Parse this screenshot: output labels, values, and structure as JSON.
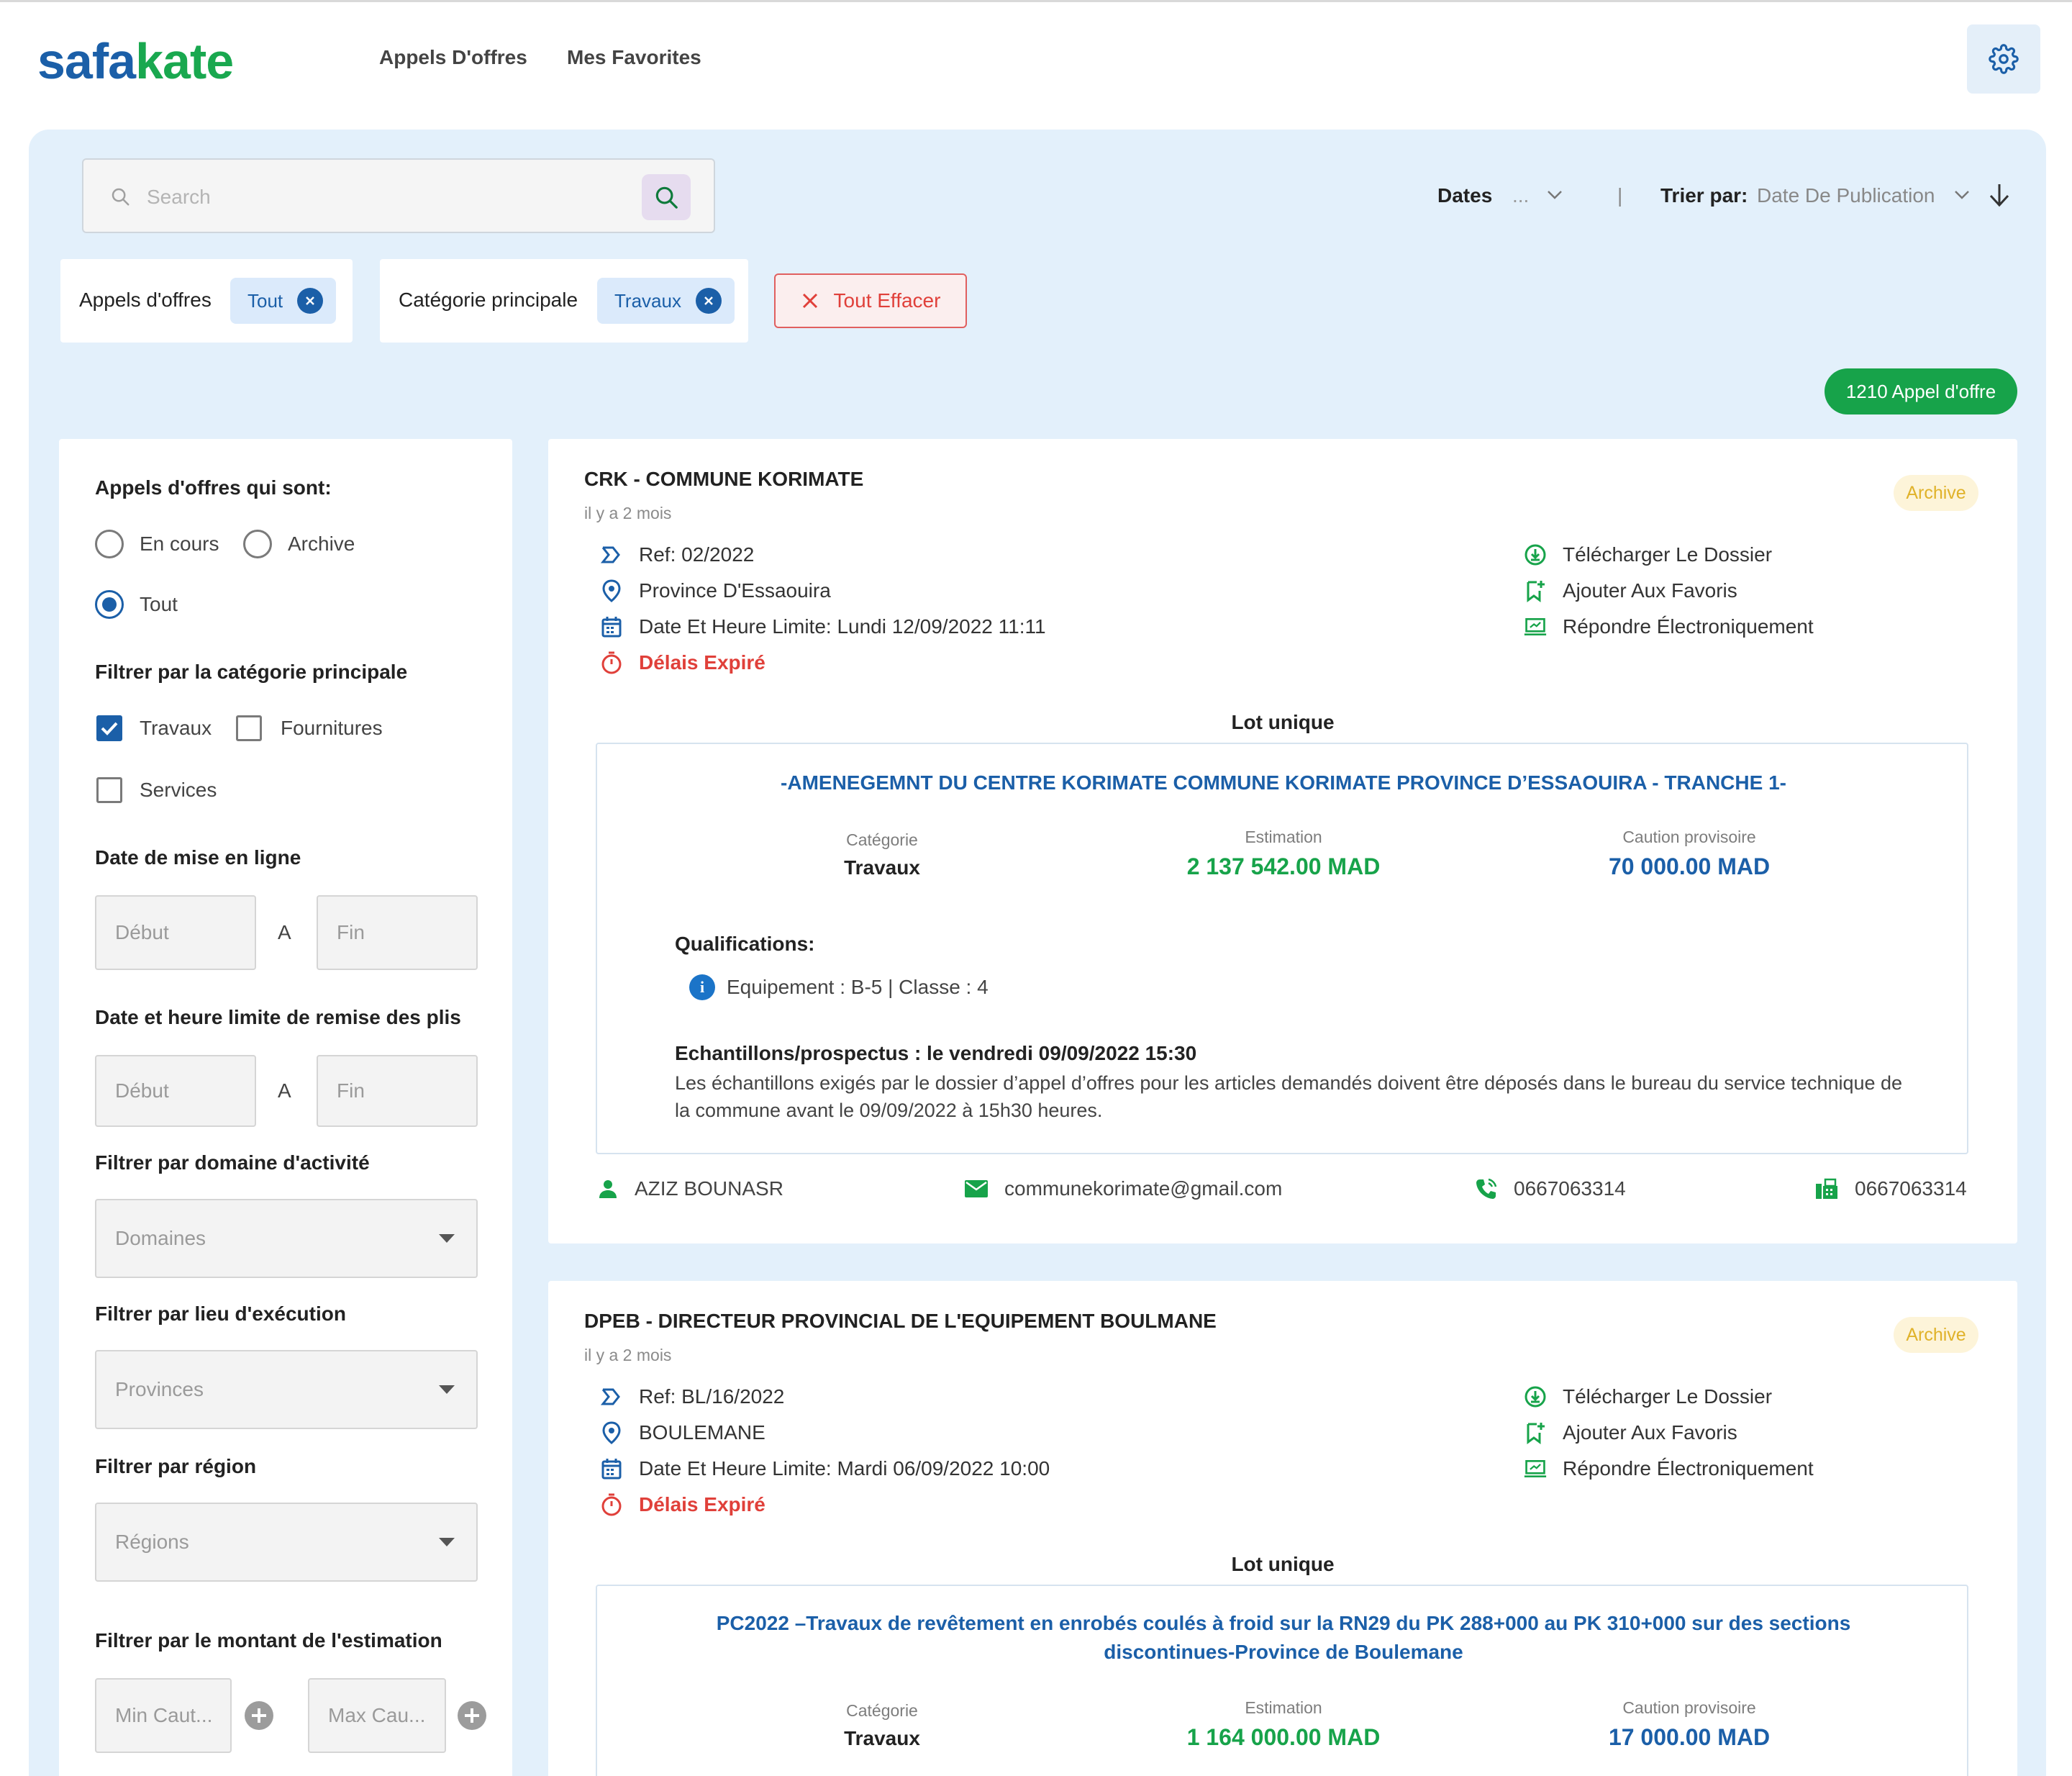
{
  "brand": {
    "logo_part1": "safa",
    "logo_part2": "kate"
  },
  "nav": {
    "items": [
      "Appels D'offres",
      "Mes Favorites"
    ]
  },
  "search": {
    "placeholder": "Search"
  },
  "sort": {
    "dates_label": "Dates",
    "dates_value": "...",
    "divider": "|",
    "sort_label": "Trier par:",
    "sort_value": "Date De Publication"
  },
  "filters_applied": [
    {
      "label": "Appels d'offres",
      "value": "Tout"
    },
    {
      "label": "Catégorie principale",
      "value": "Travaux"
    }
  ],
  "clear_all": "Tout Effacer",
  "result_count": "1210 Appel d'offre",
  "sidebar": {
    "status_title": "Appels d'offres qui sont:",
    "status_options": [
      {
        "label": "En cours",
        "selected": false
      },
      {
        "label": "Archive",
        "selected": false
      },
      {
        "label": "Tout",
        "selected": true
      }
    ],
    "category_title": "Filtrer par la catégorie principale",
    "category_options": [
      {
        "label": "Travaux",
        "checked": true
      },
      {
        "label": "Fournitures",
        "checked": false
      },
      {
        "label": "Services",
        "checked": false
      }
    ],
    "date_online_title": "Date de mise en ligne",
    "date_deadline_title": "Date et heure limite de remise des plis",
    "date_start_placeholder": "Début",
    "date_end_placeholder": "Fin",
    "date_separator": "A",
    "domain_title": "Filtrer par domaine d'activité",
    "domain_placeholder": "Domaines",
    "location_title": "Filtrer par lieu d'exécution",
    "location_placeholder": "Provinces",
    "region_title": "Filtrer par région",
    "region_placeholder": "Régions",
    "estimation_title": "Filtrer par le montant de l'estimation",
    "min_placeholder": "Min Caut...",
    "max_placeholder": "Max Cau..."
  },
  "card_actions": [
    "Télécharger Le Dossier",
    "Ajouter Aux Favoris",
    "Répondre Électroniquement"
  ],
  "labels": {
    "lot": "Lot unique",
    "category": "Catégorie",
    "estimation": "Estimation",
    "caution": "Caution provisoire",
    "qualifications": "Qualifications:"
  },
  "tenders": [
    {
      "title": "CRK - COMMUNE KORIMATE",
      "ago": "il y a 2 mois",
      "status": "Archive",
      "ref": "Ref: 02/2022",
      "location": "Province D'Essaouira",
      "deadline": "Date Et Heure Limite: Lundi 12/09/2022 11:11",
      "expired": "Délais Expiré",
      "lot_title": "-AMENEGEMNT DU CENTRE KORIMATE COMMUNE KORIMATE PROVINCE D’ESSAOUIRA - TRANCHE 1-",
      "category": "Travaux",
      "estimation": "2 137 542.00 MAD",
      "caution": "70 000.00 MAD",
      "qualification": "Equipement : B-5 | Classe : 4",
      "samples_title": "Echantillons/prospectus : le vendredi 09/09/2022 15:30",
      "samples_text": "Les échantillons exigés par le dossier d’appel d’offres pour les articles demandés doivent être déposés dans le bureau du service technique de la commune avant le 09/09/2022 à 15h30 heures.",
      "contact_name": "AZIZ BOUNASR",
      "contact_email": "communekorimate@gmail.com",
      "contact_phone": "0667063314",
      "contact_fax": "0667063314"
    },
    {
      "title": "DPEB - DIRECTEUR PROVINCIAL DE L'EQUIPEMENT BOULMANE",
      "ago": "il y a 2 mois",
      "status": "Archive",
      "ref": "Ref: BL/16/2022",
      "location": "BOULEMANE",
      "deadline": "Date Et Heure Limite: Mardi 06/09/2022 10:00",
      "expired": "Délais Expiré",
      "lot_title_line1": "PC2022 –Travaux de revêtement en enrobés coulés à froid sur la RN29 du PK 288+000 au PK 310+000 sur des sections",
      "lot_title_line2": "discontinues-Province de Boulemane",
      "category": "Travaux",
      "estimation": "1 164 000.00 MAD",
      "caution": "17 000.00 MAD"
    }
  ],
  "colors": {
    "primary": "#1b5fa8",
    "green": "#17a34a",
    "red": "#e0403a",
    "panel": "#e3f0fb"
  }
}
